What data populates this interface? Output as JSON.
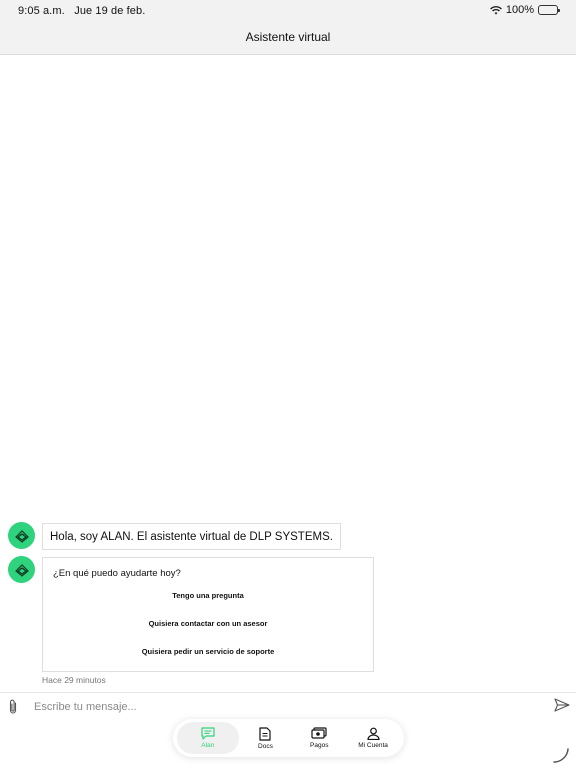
{
  "status_bar": {
    "time": "9:05 a.m.",
    "date": "Jue 19 de feb.",
    "battery_percent": "100%",
    "wifi_icon": "wifi-icon",
    "battery_icon": "battery-icon"
  },
  "nav": {
    "title": "Asistente virtual"
  },
  "chat": {
    "assistant_avatar_icon": "bot-avatar-icon",
    "messages": [
      {
        "text": "Hola, soy ALAN. El asistente virtual de DLP SYSTEMS."
      }
    ],
    "quick_replies_card": {
      "question": "¿En qué puedo ayudarte hoy?",
      "options": [
        "Tengo una pregunta",
        "Quisiera contactar con un asesor",
        "Quisiera pedir un servicio de soporte"
      ]
    },
    "timestamp": "Hace 29 minutos"
  },
  "composer": {
    "placeholder": "Escribe tu mensaje...",
    "attach_icon": "paperclip-icon",
    "send_icon": "send-icon"
  },
  "tabbar": {
    "active": "Alan",
    "tabs": [
      {
        "label": "Alan",
        "icon": "chat-icon"
      },
      {
        "label": "Docs",
        "icon": "document-icon"
      },
      {
        "label": "Pagos",
        "icon": "money-icon"
      },
      {
        "label": "Mi Cuenta",
        "icon": "person-icon"
      }
    ]
  },
  "colors": {
    "accent": "#2fd27d",
    "bar_background": "#f2f2f2",
    "border": "#dedede"
  }
}
